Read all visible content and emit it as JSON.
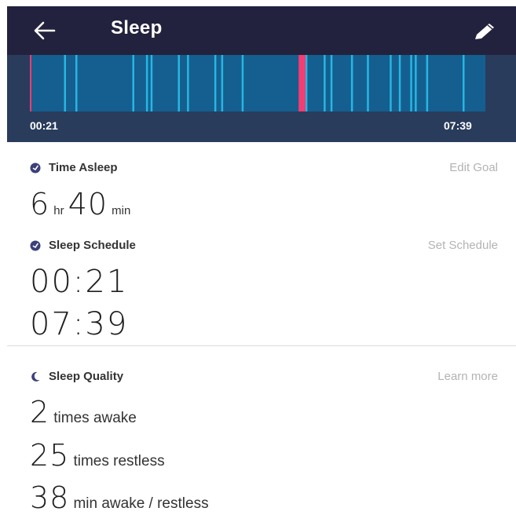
{
  "header": {
    "title": "Sleep",
    "back_icon": "arrow-left-icon",
    "edit_icon": "pencil-icon",
    "background": "#22223e"
  },
  "timeline": {
    "start_time": "00:21",
    "end_time": "07:39",
    "asleep_color": "#145f8f",
    "restless_color": "#27b6e3",
    "awake_color": "#f23d73",
    "restless_marks": [
      0.075,
      0.1,
      0.225,
      0.255,
      0.265,
      0.325,
      0.345,
      0.405,
      0.42,
      0.465,
      0.595,
      0.605,
      0.645,
      0.66,
      0.705,
      0.74,
      0.79,
      0.81,
      0.835,
      0.845,
      0.87,
      0.95
    ],
    "awake_marks": [
      {
        "start": 0.59,
        "end": 0.605
      }
    ]
  },
  "time_asleep": {
    "icon": "check-circle-icon",
    "title": "Time Asleep",
    "link": "Edit Goal",
    "hours": "6",
    "hours_unit": "hr",
    "minutes": "40",
    "minutes_unit": "min"
  },
  "sleep_schedule": {
    "icon": "check-circle-icon",
    "title": "Sleep Schedule",
    "link": "Set Schedule",
    "bedtime": "00:21",
    "wake_time": "07:39"
  },
  "sleep_quality": {
    "icon": "moon-icon",
    "title": "Sleep Quality",
    "link": "Learn more",
    "awake_count": "2",
    "awake_label": "times awake",
    "restless_count": "25",
    "restless_label": "times restless",
    "awake_restless_minutes": "38",
    "awake_restless_label": "min awake / restless"
  }
}
